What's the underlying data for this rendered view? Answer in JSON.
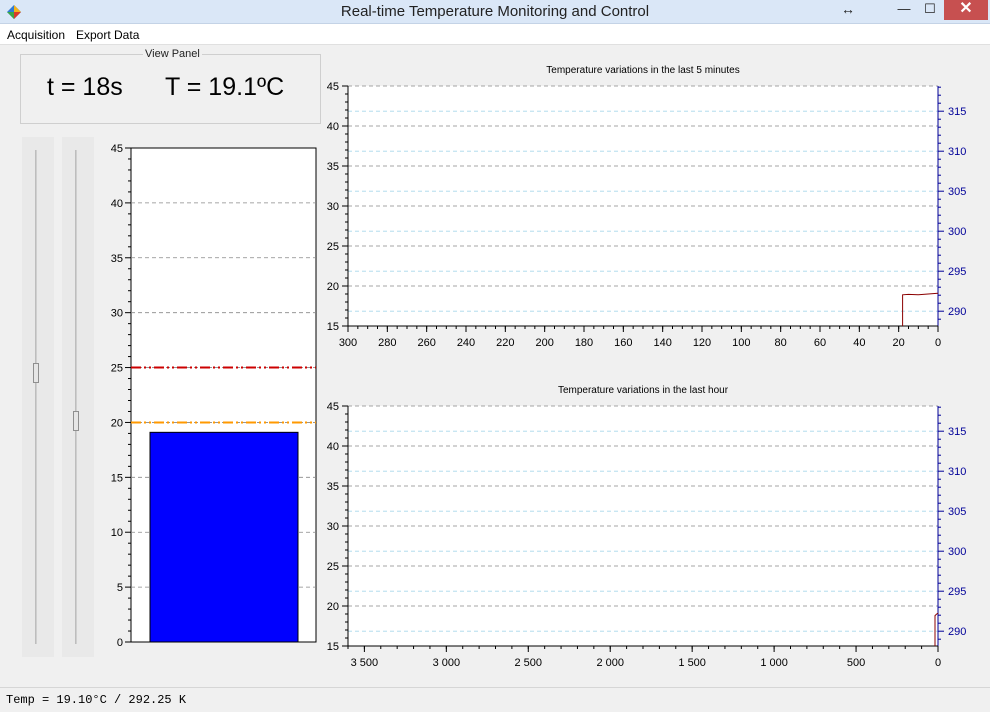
{
  "window": {
    "title": "Real-time Temperature Monitoring and Control",
    "resize_glyph": "↔",
    "minimize_glyph": "—",
    "maximize_glyph": "☐",
    "close_glyph": "✕"
  },
  "menu": {
    "items": [
      "Acquisition",
      "Export Data"
    ]
  },
  "view_panel": {
    "label": "View Panel",
    "time_text": "t = 18s",
    "temperature_text": "T = 19.1ºC"
  },
  "sliders": {
    "setpoint_high": 0.45,
    "setpoint_low": 0.55
  },
  "colors": {
    "gauge_bar": "#0000ff",
    "upper_limit": "#cc0000",
    "lower_limit": "#ff9900",
    "temperature_line": "#8b0000",
    "kelvin_axis": "#000099",
    "grid_dark": "#888888",
    "grid_light": "#a8d8ea"
  },
  "icons": {
    "app": "app-diamond-icon",
    "resize": "resize-arrows-icon"
  },
  "status": {
    "text": "Temp = 19.10°C / 292.25 K"
  },
  "chart_data": [
    {
      "type": "bar",
      "name": "gauge",
      "categories": [
        ""
      ],
      "values": [
        19.1
      ],
      "ylim": [
        0,
        45
      ],
      "yticks": [
        "0",
        "5",
        "10",
        "15",
        "20",
        "25",
        "30",
        "35",
        "40",
        "45"
      ],
      "upper_limit": 25,
      "lower_limit": 20,
      "grid": true
    },
    {
      "type": "line",
      "title": "Temperature variations in the last 5 minutes",
      "xlim": [
        300,
        0
      ],
      "ylim": [
        15,
        45
      ],
      "y2lim": [
        288.15,
        318.15
      ],
      "xticks": [
        "300",
        "280",
        "260",
        "240",
        "220",
        "200",
        "180",
        "160",
        "140",
        "120",
        "100",
        "80",
        "60",
        "40",
        "20",
        "0"
      ],
      "yticks": [
        "15",
        "20",
        "25",
        "30",
        "35",
        "40",
        "45"
      ],
      "y2ticks": [
        "290",
        "295",
        "300",
        "305",
        "310",
        "315"
      ],
      "series": [
        {
          "x": [
            18,
            18,
            15,
            10,
            5,
            0
          ],
          "y": [
            15,
            18.9,
            18.95,
            18.9,
            19.0,
            19.1
          ]
        }
      ],
      "grid": true
    },
    {
      "type": "line",
      "title": "Temperature variations in the last hour",
      "xlim": [
        3600,
        0
      ],
      "ylim": [
        15,
        45
      ],
      "y2lim": [
        288.15,
        318.15
      ],
      "xticks": [
        "3 500",
        "3 000",
        "2 500",
        "2 000",
        "1 500",
        "1 000",
        "500",
        "0"
      ],
      "yticks": [
        "15",
        "20",
        "25",
        "30",
        "35",
        "40",
        "45"
      ],
      "y2ticks": [
        "290",
        "295",
        "300",
        "305",
        "310",
        "315"
      ],
      "series": [
        {
          "x": [
            18,
            18,
            8,
            0
          ],
          "y": [
            15,
            18.8,
            19.0,
            19.1
          ]
        }
      ],
      "grid": true
    }
  ]
}
